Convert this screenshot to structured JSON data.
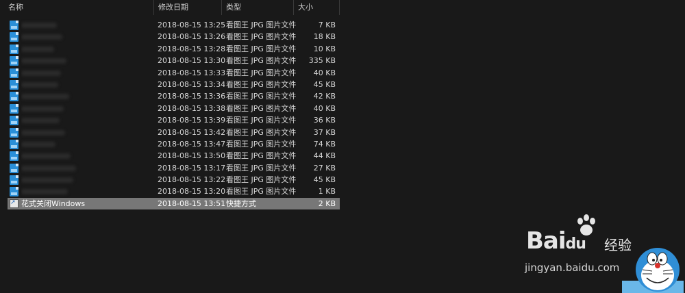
{
  "columns": {
    "name": "名称",
    "date": "修改日期",
    "type": "类型",
    "size": "大小"
  },
  "files": [
    {
      "name": "",
      "date": "2018-08-15 13:25",
      "type": "看图王 JPG 图片文件",
      "size": "7 KB",
      "icon": "jpg-file-icon"
    },
    {
      "name": "",
      "date": "2018-08-15 13:26",
      "type": "看图王 JPG 图片文件",
      "size": "18 KB",
      "icon": "jpg-file-icon"
    },
    {
      "name": "",
      "date": "2018-08-15 13:28",
      "type": "看图王 JPG 图片文件",
      "size": "10 KB",
      "icon": "jpg-file-icon"
    },
    {
      "name": "",
      "date": "2018-08-15 13:30",
      "type": "看图王 JPG 图片文件",
      "size": "335 KB",
      "icon": "jpg-file-icon"
    },
    {
      "name": "",
      "date": "2018-08-15 13:33",
      "type": "看图王 JPG 图片文件",
      "size": "40 KB",
      "icon": "jpg-file-icon"
    },
    {
      "name": "",
      "date": "2018-08-15 13:34",
      "type": "看图王 JPG 图片文件",
      "size": "45 KB",
      "icon": "jpg-file-icon"
    },
    {
      "name": "",
      "date": "2018-08-15 13:36",
      "type": "看图王 JPG 图片文件",
      "size": "42 KB",
      "icon": "jpg-file-icon"
    },
    {
      "name": "",
      "date": "2018-08-15 13:38",
      "type": "看图王 JPG 图片文件",
      "size": "40 KB",
      "icon": "jpg-file-icon"
    },
    {
      "name": "",
      "date": "2018-08-15 13:39",
      "type": "看图王 JPG 图片文件",
      "size": "36 KB",
      "icon": "jpg-file-icon"
    },
    {
      "name": "",
      "date": "2018-08-15 13:42",
      "type": "看图王 JPG 图片文件",
      "size": "37 KB",
      "icon": "jpg-file-icon"
    },
    {
      "name": "",
      "date": "2018-08-15 13:47",
      "type": "看图王 JPG 图片文件",
      "size": "74 KB",
      "icon": "jpg-file-icon"
    },
    {
      "name": "",
      "date": "2018-08-15 13:50",
      "type": "看图王 JPG 图片文件",
      "size": "44 KB",
      "icon": "jpg-file-icon"
    },
    {
      "name": "",
      "date": "2018-08-15 13:17",
      "type": "看图王 JPG 图片文件",
      "size": "27 KB",
      "icon": "jpg-file-icon"
    },
    {
      "name": "",
      "date": "2018-08-15 13:22",
      "type": "看图王 JPG 图片文件",
      "size": "45 KB",
      "icon": "jpg-file-icon"
    },
    {
      "name": "",
      "date": "2018-08-15 13:20",
      "type": "看图王 JPG 图片文件",
      "size": "1 KB",
      "icon": "jpg-file-icon"
    },
    {
      "name": "花式关闭Windows",
      "date": "2018-08-15 13:51",
      "type": "快捷方式",
      "size": "2 KB",
      "icon": "shortcut-icon",
      "selected": true
    }
  ],
  "watermark": {
    "brand": "Bai",
    "brand_du": "du",
    "cn": "经验",
    "url": "jingyan.baidu.com"
  },
  "colors": {
    "background": "#191919",
    "selected_row": "#777777",
    "jpg_icon": "#2a8fd8",
    "text": "#d8d8d8"
  }
}
